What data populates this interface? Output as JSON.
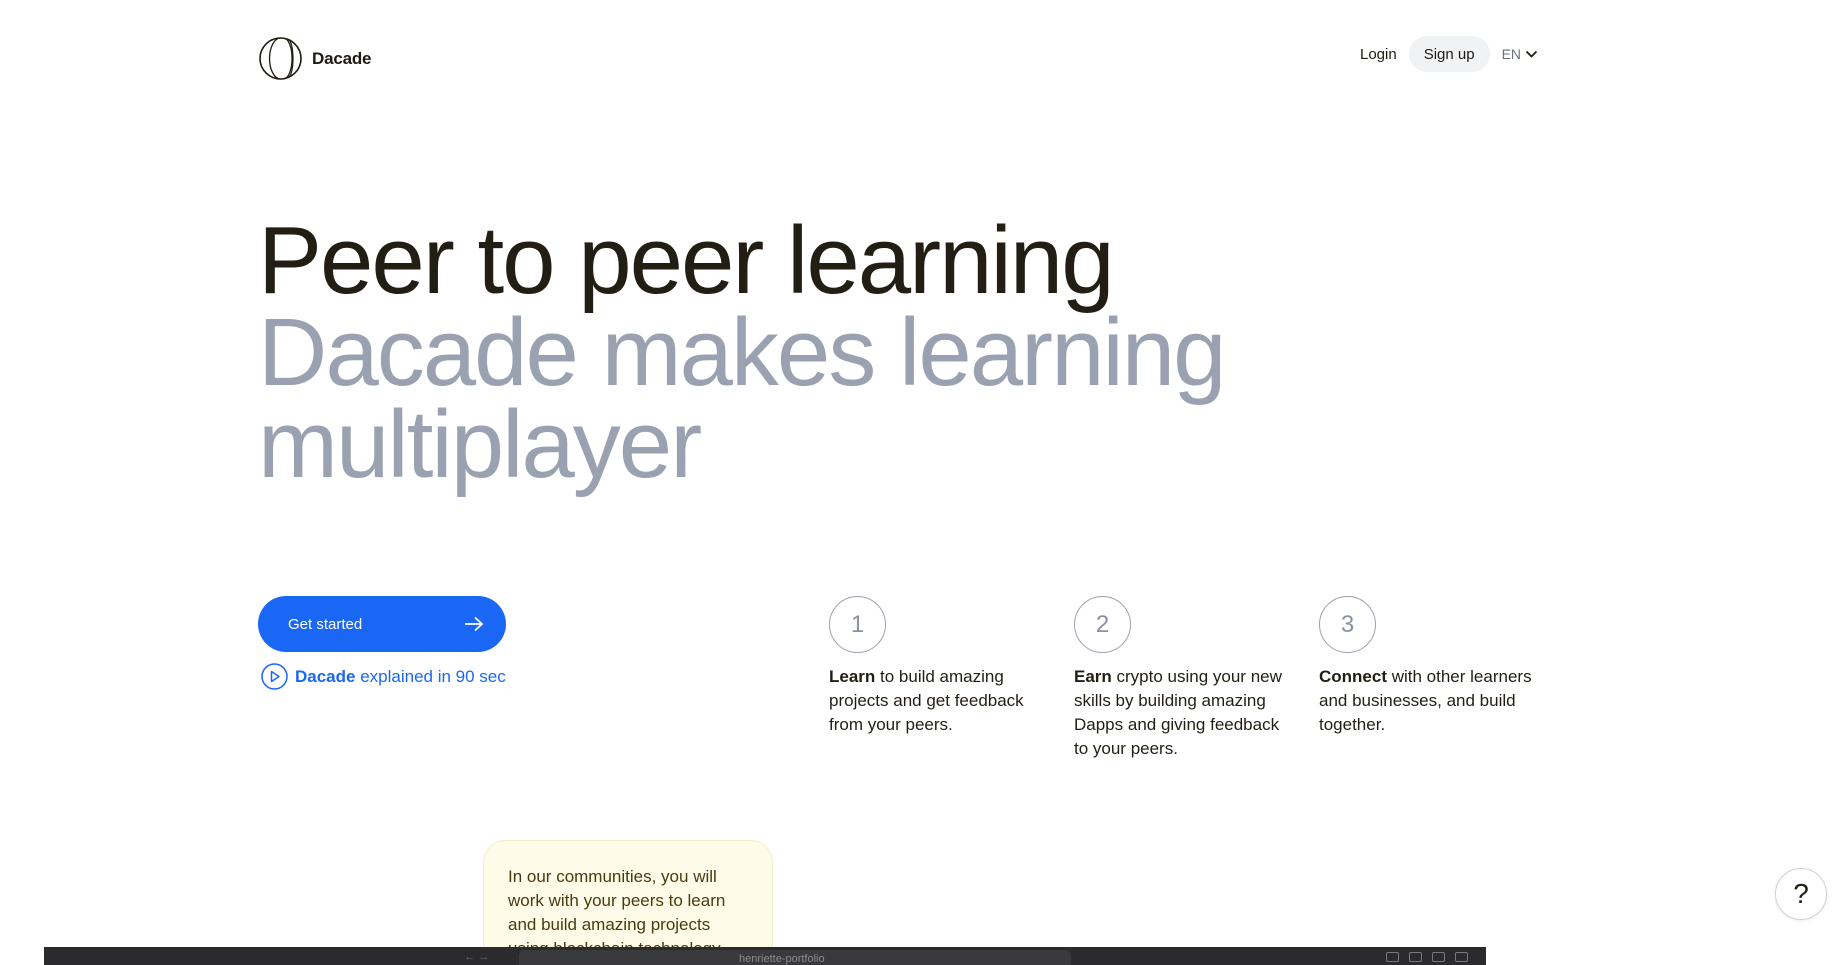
{
  "brand": {
    "name": "Dacade"
  },
  "nav": {
    "login": "Login",
    "signup": "Sign up",
    "language": "EN"
  },
  "hero": {
    "title": "Peer to peer learning",
    "subtitle": "Dacade makes learning multiplayer"
  },
  "cta": {
    "get_started": "Get started",
    "explainer_brand": "Dacade",
    "explainer_rest": " explained in 90 sec"
  },
  "steps": [
    {
      "number": "1",
      "bold": "Learn",
      "text": " to build amazing projects and get feedback from your peers."
    },
    {
      "number": "2",
      "bold": "Earn",
      "text": " crypto using your new skills by building amazing Dapps and giving feedback to your peers."
    },
    {
      "number": "3",
      "bold": "Connect",
      "text": " with other learners and businesses, and build together."
    }
  ],
  "community_card": {
    "text": "In our communities, you will work with your peers to learn and build amazing projects using blockchain technology."
  },
  "browser": {
    "url": "henriette-portfolio"
  },
  "help": {
    "label": "?"
  },
  "colors": {
    "accent": "#1b67f5",
    "muted": "#9aa1b0",
    "text": "#231e14",
    "card_bg": "#fefbe8"
  }
}
